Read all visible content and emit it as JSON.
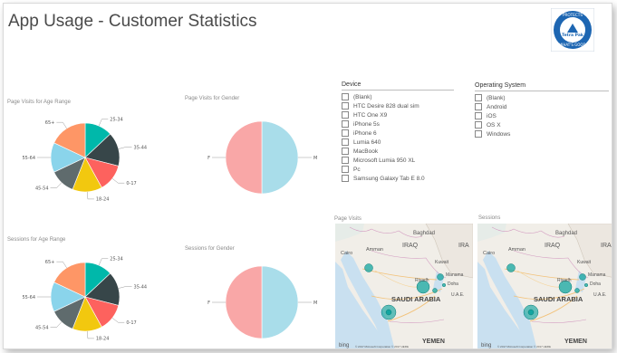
{
  "page": {
    "title": "App Usage - Customer Statistics"
  },
  "logo": {
    "top_text": "PROTECTS",
    "brand": "Tetra Pak",
    "bottom_text": "WHAT'S GOOD"
  },
  "charts": [
    {
      "id": "visits_age",
      "title": "Page Visits for Age Range",
      "type": "pie",
      "labels": [
        "25-34",
        "35-44",
        "0-17",
        "18-24",
        "45-54",
        "55-64",
        "65+"
      ],
      "values": [
        13,
        16,
        13,
        14,
        12,
        14,
        18
      ],
      "colors": [
        "#00B8AA",
        "#374649",
        "#FD625E",
        "#F2C80F",
        "#5F6B6D",
        "#8AD4EB",
        "#FE9666"
      ]
    },
    {
      "id": "visits_gender",
      "title": "Page Visits for Gender",
      "type": "pie",
      "labels": [
        "M",
        "F"
      ],
      "values": [
        50,
        50
      ],
      "colors": [
        "#A9DDEA",
        "#F9A7A7"
      ]
    },
    {
      "id": "sessions_age",
      "title": "Sessions for Age Range",
      "type": "pie",
      "labels": [
        "25-34",
        "35-44",
        "0-17",
        "18-24",
        "45-54",
        "55-64",
        "65+"
      ],
      "values": [
        13,
        16,
        13,
        14,
        12,
        14,
        18
      ],
      "colors": [
        "#00B8AA",
        "#374649",
        "#FD625E",
        "#F2C80F",
        "#5F6B6D",
        "#8AD4EB",
        "#FE9666"
      ]
    },
    {
      "id": "sessions_gender",
      "title": "Sessions for Gender",
      "type": "pie",
      "labels": [
        "M",
        "F"
      ],
      "values": [
        50,
        50
      ],
      "colors": [
        "#A9DDEA",
        "#F9A7A7"
      ]
    }
  ],
  "chart_data": [
    {
      "type": "pie",
      "title": "Page Visits for Age Range",
      "labels": [
        "25-34",
        "35-44",
        "0-17",
        "18-24",
        "45-54",
        "55-64",
        "65+"
      ],
      "values": [
        13,
        16,
        13,
        14,
        12,
        14,
        18
      ]
    },
    {
      "type": "pie",
      "title": "Page Visits for Gender",
      "labels": [
        "M",
        "F"
      ],
      "values": [
        50,
        50
      ]
    },
    {
      "type": "pie",
      "title": "Sessions for Age Range",
      "labels": [
        "25-34",
        "35-44",
        "0-17",
        "18-24",
        "45-54",
        "55-64",
        "65+"
      ],
      "values": [
        13,
        16,
        13,
        14,
        12,
        14,
        18
      ]
    },
    {
      "type": "pie",
      "title": "Sessions for Gender",
      "labels": [
        "M",
        "F"
      ],
      "values": [
        50,
        50
      ]
    }
  ],
  "slicers": {
    "device": {
      "header": "Device",
      "items": [
        "(Blank)",
        "HTC Desire 828 dual sim",
        "HTC One X9",
        "iPhone 5s",
        "iPhone 6",
        "Lumia 640",
        "MacBook",
        "Microsoft Lumia 950 XL",
        "Pc",
        "Samsung Galaxy Tab E 8.0"
      ]
    },
    "os": {
      "header": "Operating System",
      "items": [
        "(Blank)",
        "Android",
        "iOS",
        "OS X",
        "Windows"
      ]
    }
  },
  "maps": [
    {
      "id": "page_visits",
      "title": "Page Visits",
      "labels": {
        "baghdad": "Baghdad",
        "iraq": "IRAQ",
        "iran": "IRA",
        "amman": "Amman",
        "cairo": "Cairo",
        "kuwait": "Kuwait",
        "riyadh": "Riyadh",
        "manama": "Manama",
        "doha": "Doha",
        "uae": "U.A.E.",
        "saudi": "SAUDI ARABIA",
        "yemen": "YEMEN",
        "bing": "bing",
        "copyright": "© 2017 Microsoft Corporation © 2017 HERE"
      }
    },
    {
      "id": "sessions",
      "title": "Sessions",
      "labels": {
        "baghdad": "Baghdad",
        "iraq": "IRAQ",
        "iran": "IRA",
        "amman": "Amman",
        "cairo": "Cairo",
        "kuwait": "Kuwait",
        "riyadh": "Riyadh",
        "manama": "Manama",
        "doha": "Doha",
        "uae": "U.A.E.",
        "saudi": "SAUDI ARABIA",
        "yemen": "YEMEN",
        "bing": "bing",
        "copyright": "© 2017 Microsoft Corporation © 2017 HERE"
      }
    }
  ]
}
